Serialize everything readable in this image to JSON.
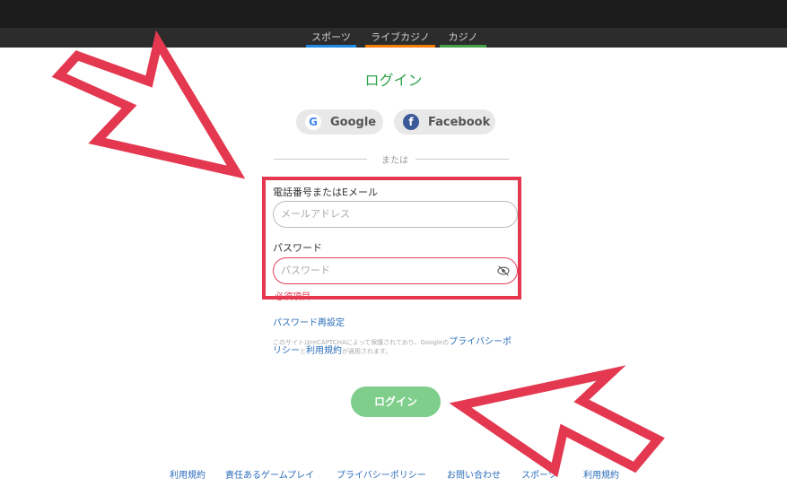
{
  "nav": {
    "tabs": [
      {
        "label": "スポーツ",
        "color": "#1e88e5"
      },
      {
        "label": "ライブカジノ",
        "color": "#f57c00"
      },
      {
        "label": "カジノ",
        "color": "#43a047"
      }
    ]
  },
  "login": {
    "title": "ログイン",
    "google_label": "Google",
    "facebook_label": "Facebook",
    "or_text": "または",
    "email_label": "電話番号またはEメール",
    "email_placeholder": "メールアドレス",
    "password_label": "パスワード",
    "password_placeholder": "パスワード",
    "error_text": "必須項目",
    "reset_link": "パスワード再設定",
    "recaptcha_prefix": "このサイトはreCAPTCHAによって保護されており、Googleの",
    "recaptcha_privacy": "プライバシーポリシー",
    "recaptcha_and": "と",
    "recaptcha_terms": "利用規約",
    "recaptcha_suffix": "が適用されます。",
    "submit_label": "ログイン"
  },
  "footer": {
    "links": [
      "利用規約",
      "責任あるゲームプレイ",
      "プライバシーポリシー",
      "お問い合わせ",
      "スポーツ",
      "利用規約"
    ]
  },
  "colors": {
    "accent_green": "#2ea34a",
    "highlight_red": "#e3384f",
    "link_blue": "#2a6ebb"
  }
}
